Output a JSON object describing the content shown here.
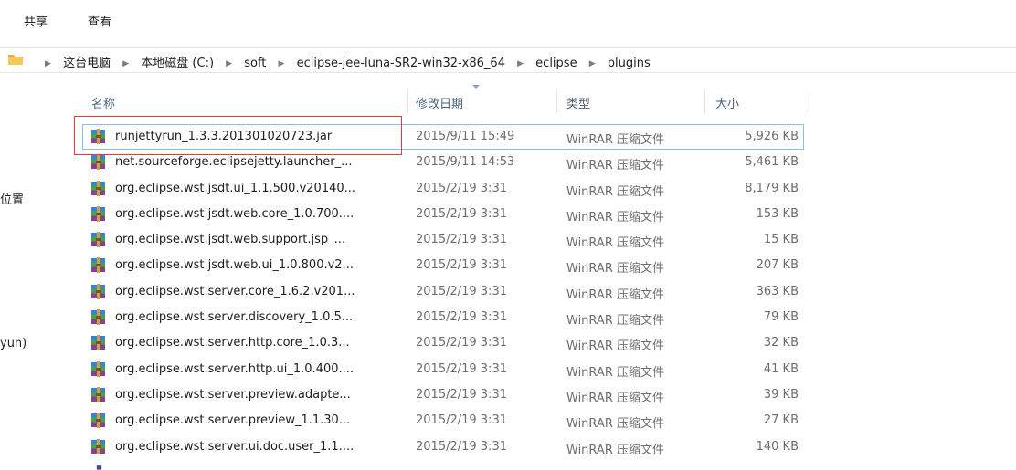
{
  "ribbon": {
    "tabs": [
      "共享",
      "查看"
    ]
  },
  "address": {
    "path": [
      "这台电脑",
      "本地磁盘 (C:)",
      "soft",
      "eclipse-jee-luna-SR2-win32-x86_64",
      "eclipse",
      "plugins"
    ]
  },
  "nav": {
    "items": [
      "位置",
      "yun)"
    ]
  },
  "columns": {
    "name": "名称",
    "date": "修改日期",
    "type": "类型",
    "size": "大小"
  },
  "files": [
    {
      "name": "runjettyrun_1.3.3.201301020723.jar",
      "date": "2015/9/11 15:49",
      "type": "WinRAR 压缩文件",
      "size": "5,926 KB"
    },
    {
      "name": "net.sourceforge.eclipsejetty.launcher_...",
      "date": "2015/9/11 14:53",
      "type": "WinRAR 压缩文件",
      "size": "5,461 KB"
    },
    {
      "name": "org.eclipse.wst.jsdt.ui_1.1.500.v20140...",
      "date": "2015/2/19 3:31",
      "type": "WinRAR 压缩文件",
      "size": "8,179 KB"
    },
    {
      "name": "org.eclipse.wst.jsdt.web.core_1.0.700....",
      "date": "2015/2/19 3:31",
      "type": "WinRAR 压缩文件",
      "size": "153 KB"
    },
    {
      "name": "org.eclipse.wst.jsdt.web.support.jsp_...",
      "date": "2015/2/19 3:31",
      "type": "WinRAR 压缩文件",
      "size": "15 KB"
    },
    {
      "name": "org.eclipse.wst.jsdt.web.ui_1.0.800.v2...",
      "date": "2015/2/19 3:31",
      "type": "WinRAR 压缩文件",
      "size": "207 KB"
    },
    {
      "name": "org.eclipse.wst.server.core_1.6.2.v201...",
      "date": "2015/2/19 3:31",
      "type": "WinRAR 压缩文件",
      "size": "363 KB"
    },
    {
      "name": "org.eclipse.wst.server.discovery_1.0.5...",
      "date": "2015/2/19 3:31",
      "type": "WinRAR 压缩文件",
      "size": "79 KB"
    },
    {
      "name": "org.eclipse.wst.server.http.core_1.0.3...",
      "date": "2015/2/19 3:31",
      "type": "WinRAR 压缩文件",
      "size": "32 KB"
    },
    {
      "name": "org.eclipse.wst.server.http.ui_1.0.400....",
      "date": "2015/2/19 3:31",
      "type": "WinRAR 压缩文件",
      "size": "41 KB"
    },
    {
      "name": "org.eclipse.wst.server.preview.adapte...",
      "date": "2015/2/19 3:31",
      "type": "WinRAR 压缩文件",
      "size": "39 KB"
    },
    {
      "name": "org.eclipse.wst.server.preview_1.1.30...",
      "date": "2015/2/19 3:31",
      "type": "WinRAR 压缩文件",
      "size": "27 KB"
    },
    {
      "name": "org.eclipse.wst.server.ui.doc.user_1.1....",
      "date": "2015/2/19 3:31",
      "type": "WinRAR 压缩文件",
      "size": "140 KB"
    }
  ],
  "icons": {
    "file": "winrar-archive-icon",
    "folder": "folder-icon"
  },
  "colors": {
    "highlight": "#e03c3c",
    "selection": "#8fbce6",
    "header_text": "#4c607a"
  }
}
